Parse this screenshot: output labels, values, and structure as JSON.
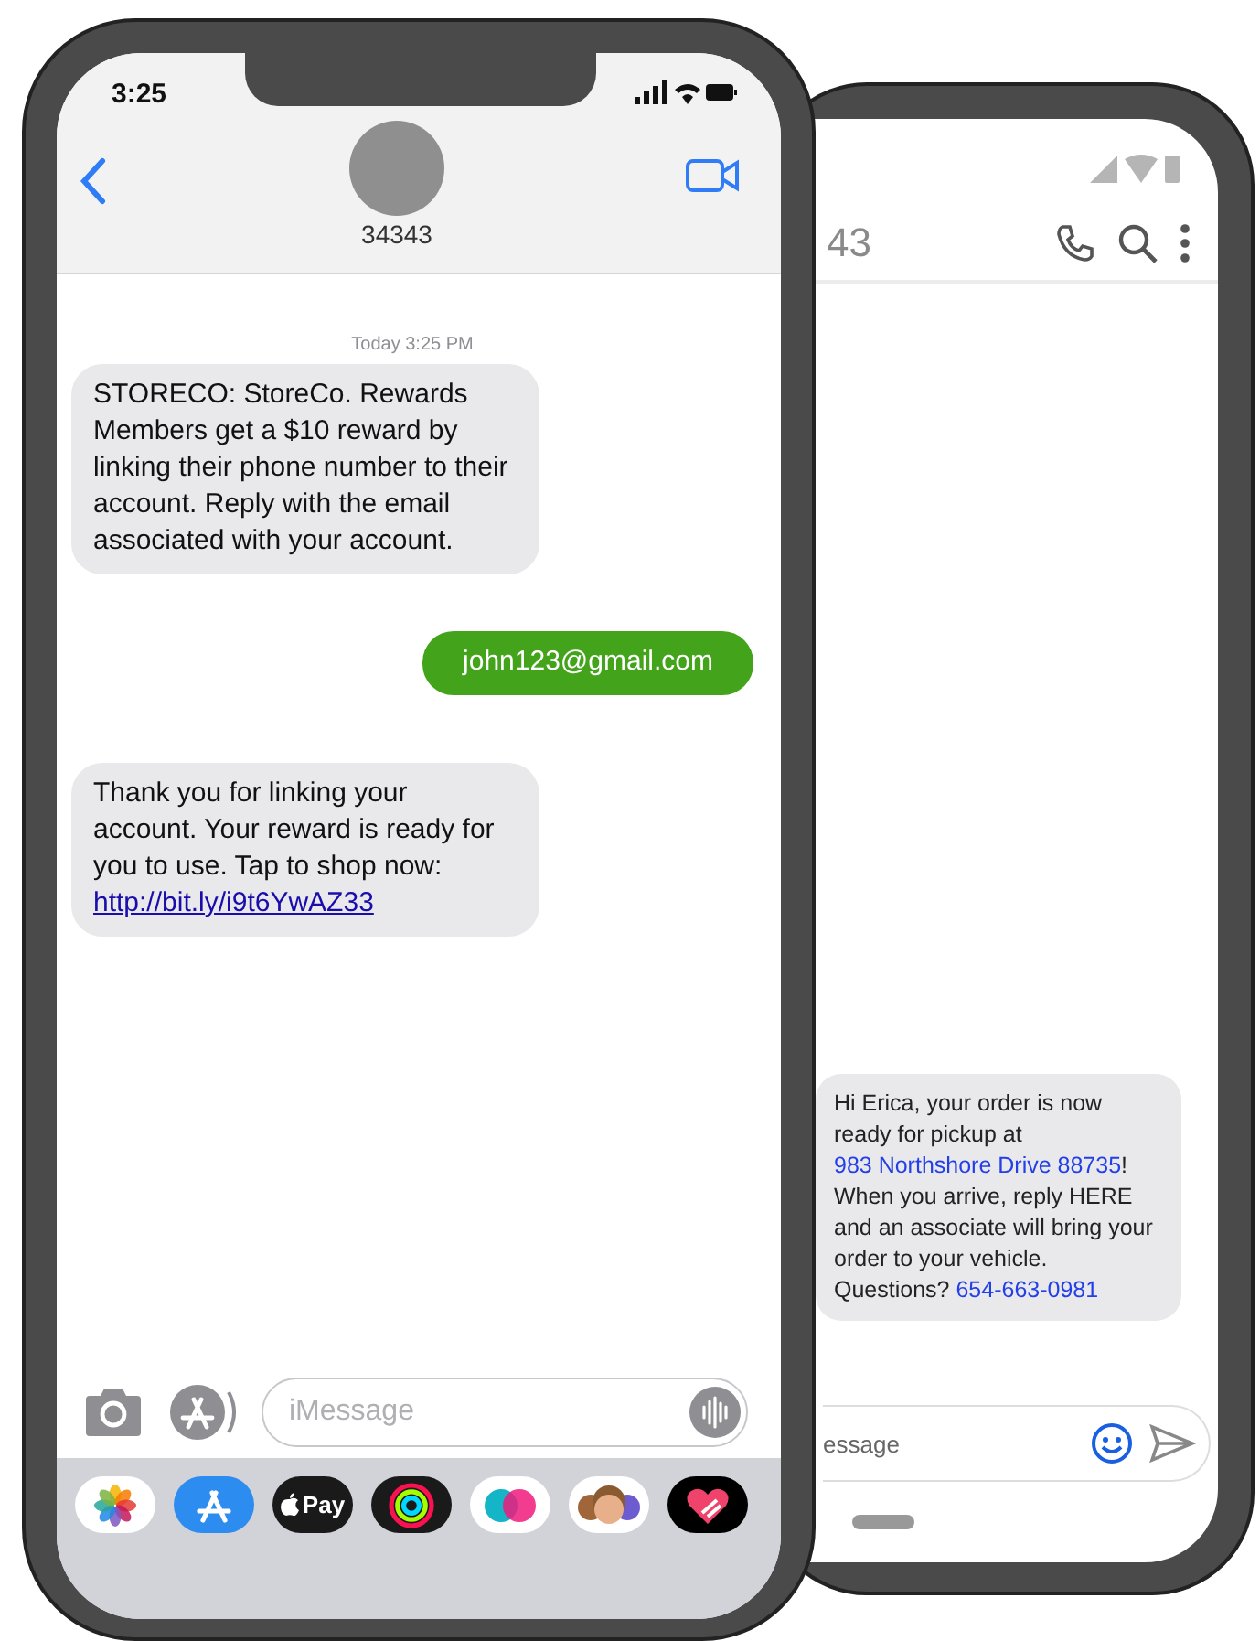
{
  "front_phone": {
    "status_bar": {
      "time": "3:25"
    },
    "contact": "34343",
    "timestamp": "Today 3:25 PM",
    "messages": [
      {
        "kind": "incoming",
        "parts": [
          {
            "kind": "text",
            "text": "STORECO: StoreCo. Rewards Members get a $10 reward by linking their phone number to their account. Reply with the email associated with your account."
          }
        ]
      },
      {
        "kind": "outgoing",
        "parts": [
          {
            "kind": "text",
            "text": "john123@gmail.com"
          }
        ]
      },
      {
        "kind": "incoming",
        "parts": [
          {
            "kind": "text",
            "text": "Thank you for linking your account. Your reward is ready for you to use. Tap to shop now: "
          },
          {
            "kind": "link",
            "text": "http://bit.ly/i9t6YwAZ33"
          }
        ]
      }
    ],
    "input": {
      "placeholder": "iMessage"
    },
    "app_drawer": [
      {
        "kind": "photos"
      },
      {
        "kind": "app-store"
      },
      {
        "kind": "apple-pay",
        "label": "Pay"
      },
      {
        "kind": "activity"
      },
      {
        "kind": "digital-touch"
      },
      {
        "kind": "memoji"
      },
      {
        "kind": "heart"
      }
    ]
  },
  "back_phone": {
    "title": "43",
    "messages": [
      {
        "kind": "incoming",
        "parts": [
          {
            "kind": "text",
            "text": "Hi Erica, your order is now ready for pickup at "
          },
          {
            "kind": "link",
            "text": "983 Northshore Drive 88735"
          },
          {
            "kind": "text",
            "text": "! When you arrive, reply HERE and an associate will bring your order to your vehicle. Questions? "
          },
          {
            "kind": "link",
            "text": "654-663-0981"
          }
        ]
      }
    ],
    "input": {
      "placeholder": "essage"
    }
  }
}
